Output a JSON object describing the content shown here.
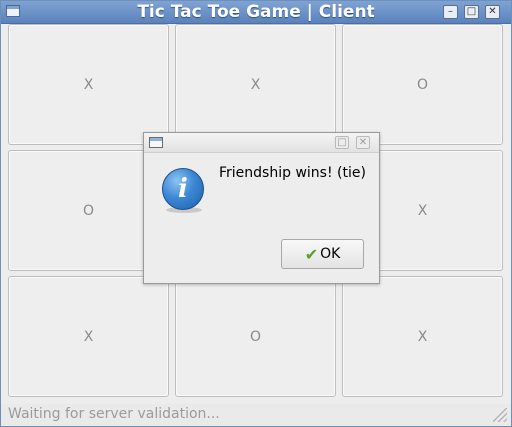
{
  "window": {
    "title": "Tic Tac Toe Game | Client",
    "buttons": {
      "minimize": "–",
      "maximize": "□",
      "close": "✕"
    }
  },
  "board": {
    "cells": [
      "X",
      "X",
      "O",
      "O",
      "",
      "X",
      "X",
      "O",
      "X"
    ]
  },
  "status": {
    "text": "Waiting for server validation..."
  },
  "dialog": {
    "message": "Friendship wins! (tie)",
    "ok_label": "OK",
    "icon": "info-icon",
    "buttons": {
      "maximize": "□",
      "close": "✕"
    }
  },
  "colors": {
    "titlebar": "#6b91c8",
    "accent": "#3c88d4",
    "check": "#5aa02c"
  }
}
